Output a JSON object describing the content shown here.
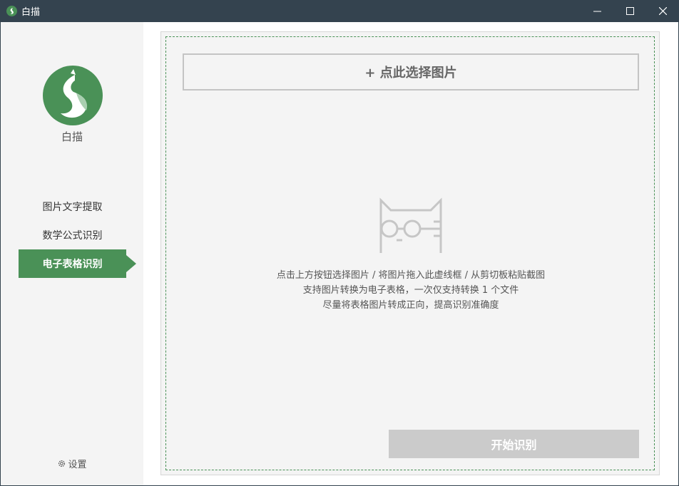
{
  "window": {
    "title": "白描",
    "accent_color": "#4a9157",
    "titlebar_color": "#34434f"
  },
  "sidebar": {
    "brand": "白描",
    "nav": [
      {
        "label": "图片文字提取",
        "active": false
      },
      {
        "label": "数学公式识别",
        "active": false
      },
      {
        "label": "电子表格识别",
        "active": true
      }
    ],
    "settings_label": "设置"
  },
  "main": {
    "pick_button": "+ 点此选择图片",
    "hints": [
      "点击上方按钮选择图片 / 将图片拖入此虚线框 / 从剪切板粘贴截图",
      "支持图片转换为电子表格，一次仅支持转换 1 个文件",
      "尽量将表格图片转成正向，提高识别准确度"
    ],
    "start_button": "开始识别",
    "start_button_color": "#cbcbcb"
  },
  "icons": [
    "app-logo-icon",
    "minimize-icon",
    "maximize-icon",
    "close-icon",
    "cat-glasses-icon",
    "gear-icon"
  ]
}
